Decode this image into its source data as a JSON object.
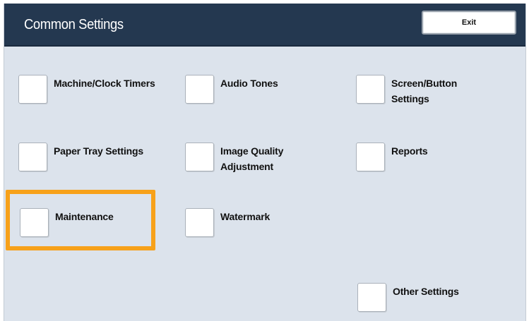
{
  "header": {
    "title": "Common Settings",
    "exit_label": "Exit"
  },
  "options": {
    "machine_clock_timers": "Machine/Clock Timers",
    "audio_tones": "Audio Tones",
    "screen_button_settings": "Screen/Button Settings",
    "paper_tray_settings": "Paper Tray Settings",
    "image_quality_adjustment": "Image Quality Adjustment",
    "reports": "Reports",
    "maintenance": "Maintenance",
    "watermark": "Watermark",
    "other_settings": "Other Settings"
  },
  "highlight": {
    "target": "maintenance",
    "color": "#f7a11a"
  },
  "colors": {
    "header_bg": "#243850",
    "panel_bg": "#dce3ec"
  }
}
